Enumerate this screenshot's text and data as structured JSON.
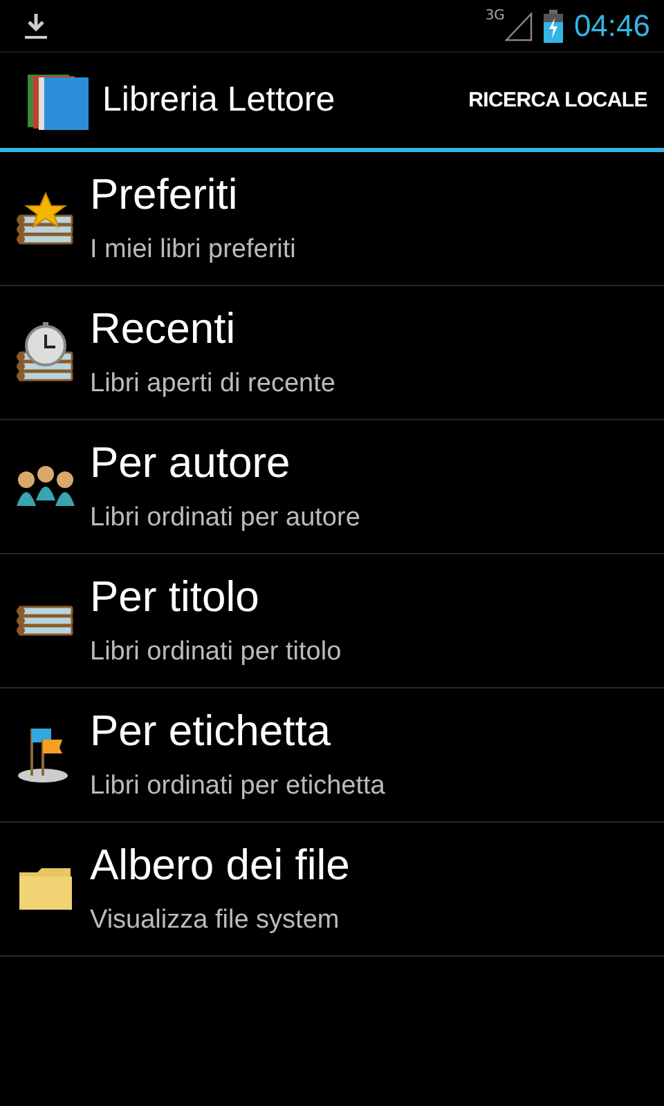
{
  "status_bar": {
    "network": "3G",
    "time": "04:46"
  },
  "action_bar": {
    "title": "Libreria Lettore",
    "action": "RICERCA LOCALE"
  },
  "items": [
    {
      "kind": "favorites",
      "title": "Preferiti",
      "subtitle": "I miei libri preferiti"
    },
    {
      "kind": "recent",
      "title": "Recenti",
      "subtitle": "Libri aperti di recente"
    },
    {
      "kind": "authors",
      "title": "Per autore",
      "subtitle": "Libri ordinati per autore"
    },
    {
      "kind": "titles",
      "title": "Per titolo",
      "subtitle": "Libri ordinati per titolo"
    },
    {
      "kind": "tags",
      "title": "Per etichetta",
      "subtitle": "Libri ordinati per etichetta"
    },
    {
      "kind": "folder",
      "title": "Albero dei file",
      "subtitle": "Visualizza file system"
    }
  ]
}
